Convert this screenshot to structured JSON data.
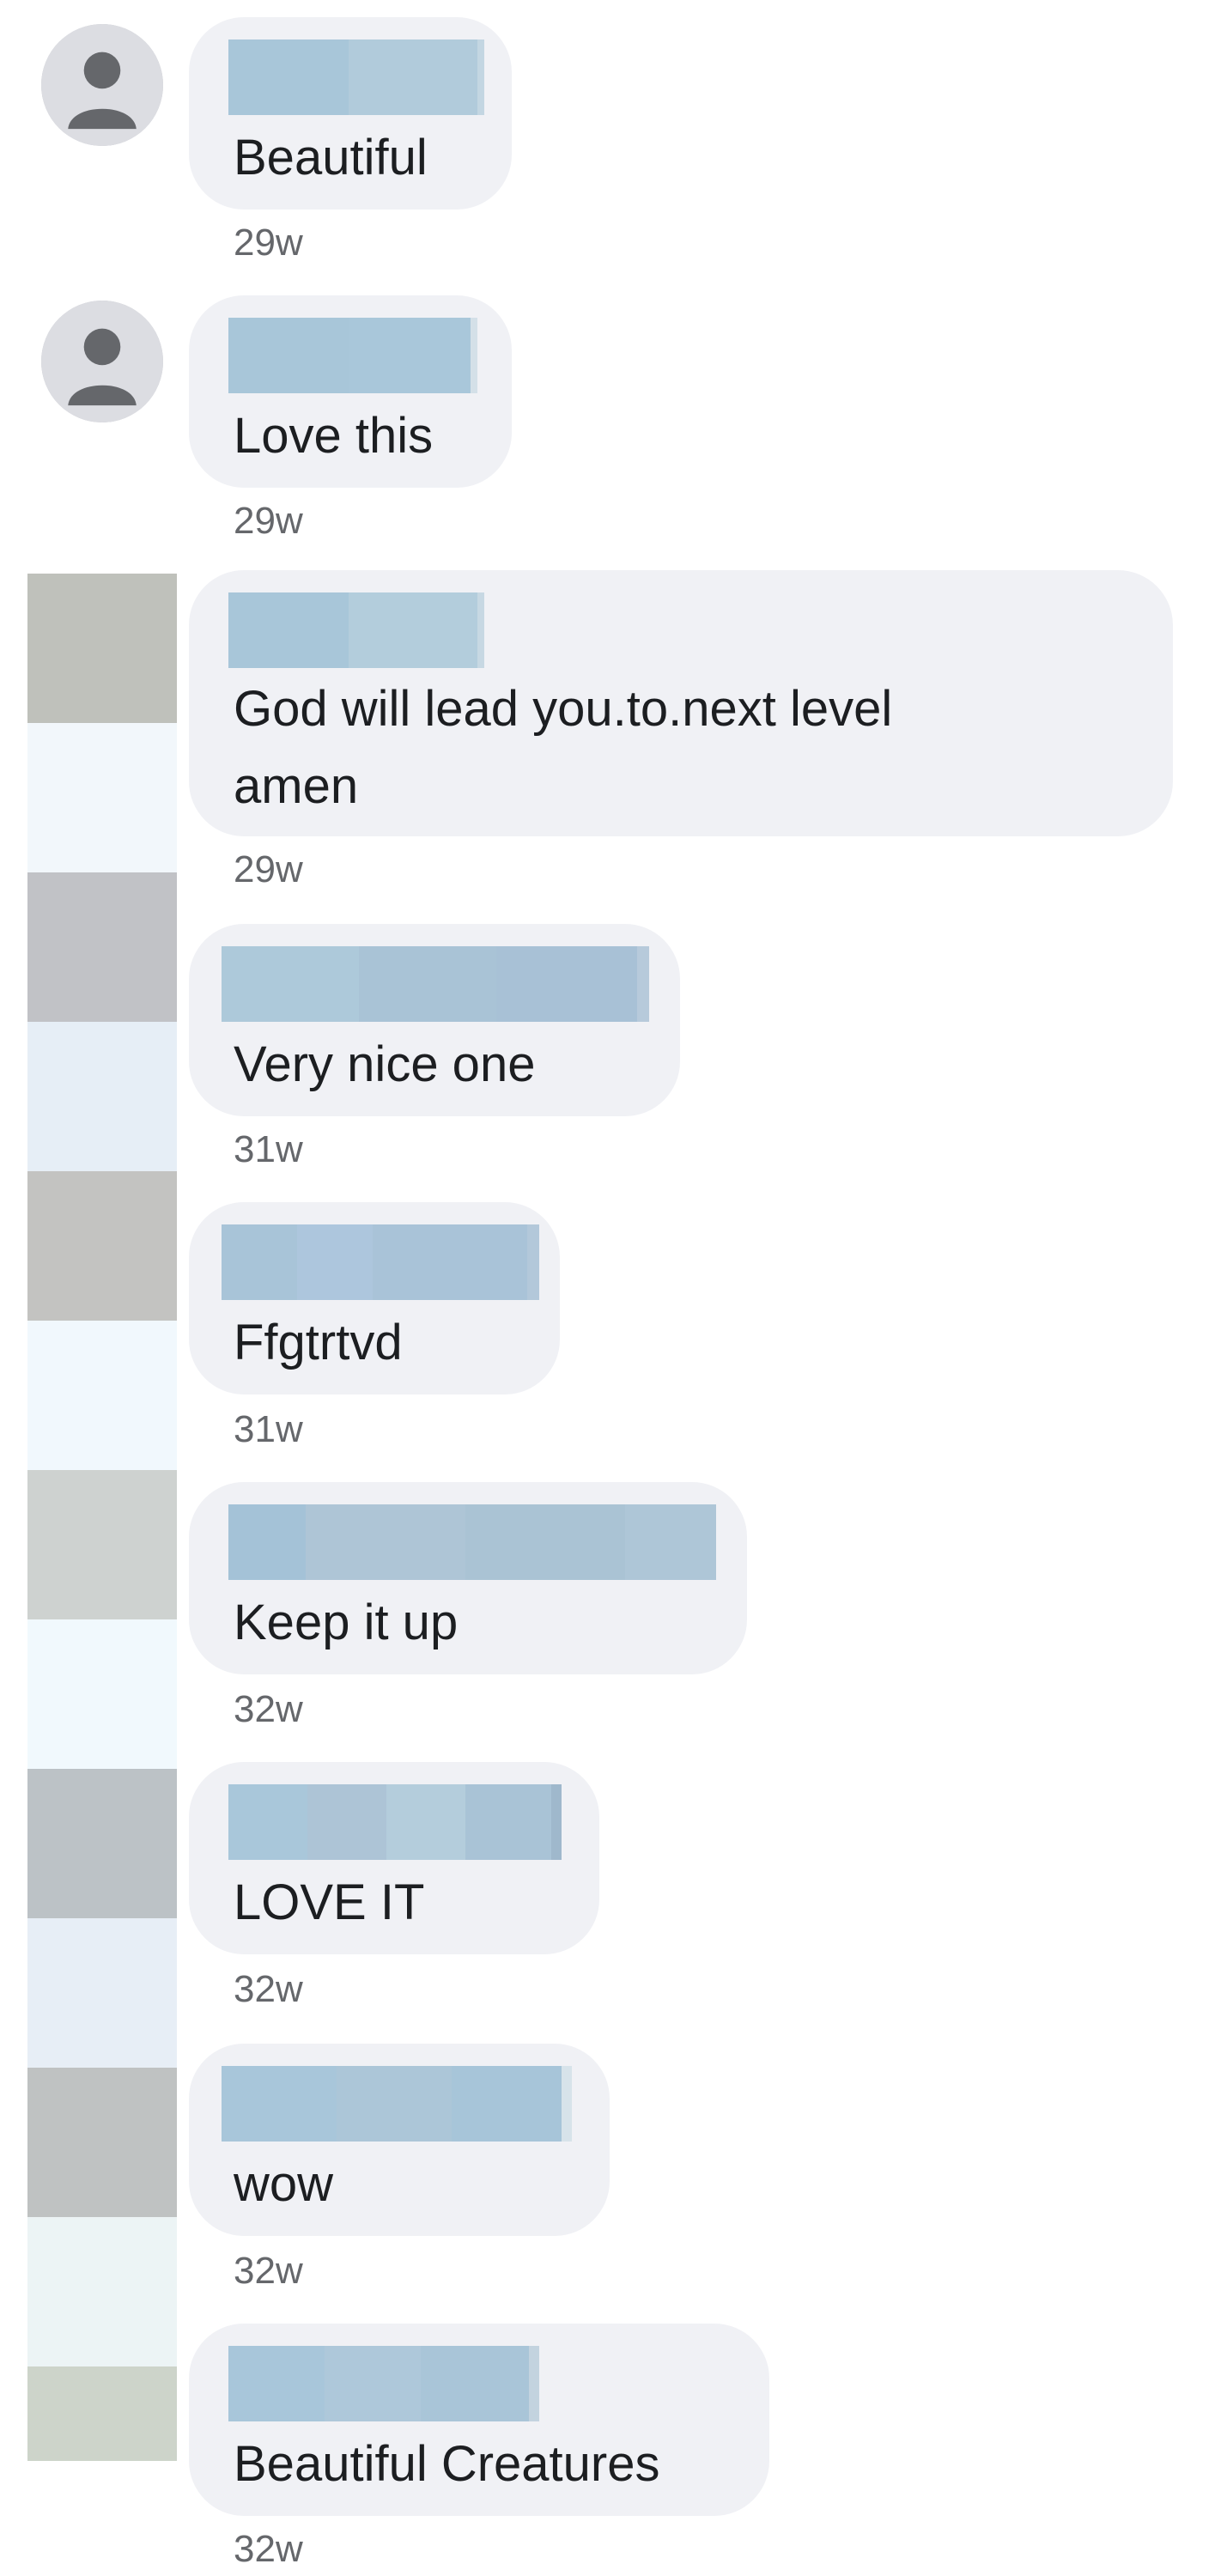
{
  "comments": [
    {
      "text": "Beautiful",
      "time": "29w"
    },
    {
      "text": "Love this",
      "time": "29w"
    },
    {
      "text": [
        "God will lead you.to.next level",
        "amen"
      ],
      "time": "29w"
    },
    {
      "text": "Very nice one",
      "time": "31w"
    },
    {
      "text": "Ffgtrtvd",
      "time": "31w"
    },
    {
      "text": "Keep it up",
      "time": "32w"
    },
    {
      "text": "LOVE IT",
      "time": "32w"
    },
    {
      "text": "wow",
      "time": "32w"
    },
    {
      "text": "Beautiful Creatures",
      "time": "32w"
    }
  ],
  "icons": {
    "default_avatar": "person-silhouette-icon"
  },
  "colors": {
    "bubble": "#f0f1f5",
    "timestamp": "#65676b",
    "text": "#1c1e21",
    "redaction": "#a9c7da"
  }
}
